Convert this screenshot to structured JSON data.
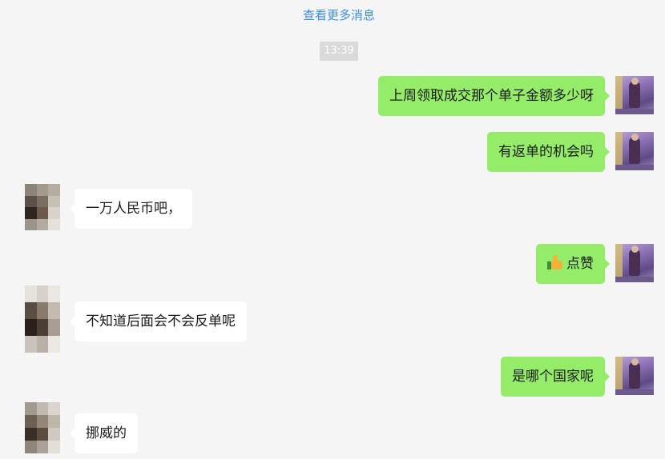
{
  "header": {
    "load_more": "查看更多消息"
  },
  "timestamp": "13:39",
  "messages": [
    {
      "side": "right",
      "text": "上周领取成交那个单子金额多少呀"
    },
    {
      "side": "right",
      "text": "有返单的机会吗"
    },
    {
      "side": "left",
      "text": "一万人民币吧，"
    },
    {
      "side": "right",
      "text": "点赞",
      "emoji": "thumbs-up"
    },
    {
      "side": "left",
      "text": "不知道后面会不会反单呢"
    },
    {
      "side": "right",
      "text": "是哪个国家呢"
    },
    {
      "side": "left",
      "text": "挪威的"
    }
  ],
  "colors": {
    "self_bubble": "#95ec69",
    "other_bubble": "#ffffff",
    "background": "#f5f5f5",
    "link": "#3d8ee8"
  }
}
